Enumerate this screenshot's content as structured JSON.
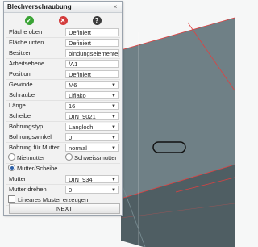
{
  "dialog": {
    "title": "Blechverschraubung",
    "close_glyph": "×",
    "actions": [
      {
        "name": "check-icon",
        "glyph": "✓"
      },
      {
        "name": "cancel-icon",
        "glyph": "✕"
      },
      {
        "name": "help-icon",
        "glyph": "?"
      }
    ],
    "fields": [
      {
        "label": "Fläche oben",
        "value": "Definiert",
        "kind": "static"
      },
      {
        "label": "Fläche unten",
        "value": "Definiert",
        "kind": "static"
      },
      {
        "label": "Besitzer",
        "value": "bindungselemente",
        "kind": "input"
      },
      {
        "label": "Arbeitsebene",
        "value": "/A1",
        "kind": "input"
      },
      {
        "label": "Position",
        "value": "Definiert",
        "kind": "static"
      },
      {
        "label": "Gewinde",
        "value": "M6",
        "kind": "dropdown"
      },
      {
        "label": "Schraube",
        "value": "Liflako",
        "kind": "dropdown"
      },
      {
        "label": "Länge",
        "value": "16",
        "kind": "dropdown"
      },
      {
        "label": "Scheibe",
        "value": "DIN_9021",
        "kind": "dropdown"
      },
      {
        "label": "Bohrungstyp",
        "value": "Langloch",
        "kind": "dropdown"
      },
      {
        "label": "Bohrungswinkel",
        "value": "0",
        "kind": "dropdown"
      },
      {
        "label": "Bohrung für Mutter",
        "value": "normal",
        "kind": "dropdown"
      }
    ],
    "radio_options": {
      "nietmutter": "Nietmutter",
      "schweissmutter": "Schweissmutter",
      "mutter_scheibe": "Mutter/Scheibe"
    },
    "fields2": [
      {
        "label": "Mutter",
        "value": "DIN_934",
        "kind": "dropdown"
      },
      {
        "label": "Mutter drehen",
        "value": "0",
        "kind": "dropdown"
      }
    ],
    "checkbox_label": "Lineares Muster erzeugen",
    "next_label": "NEXT"
  },
  "colors": {
    "plate_top": "#8a9ba0",
    "plate_side": "#4f5e63",
    "accent_red": "#e04040",
    "ok_green": "#3aa335",
    "cancel_red": "#d33b3b"
  }
}
